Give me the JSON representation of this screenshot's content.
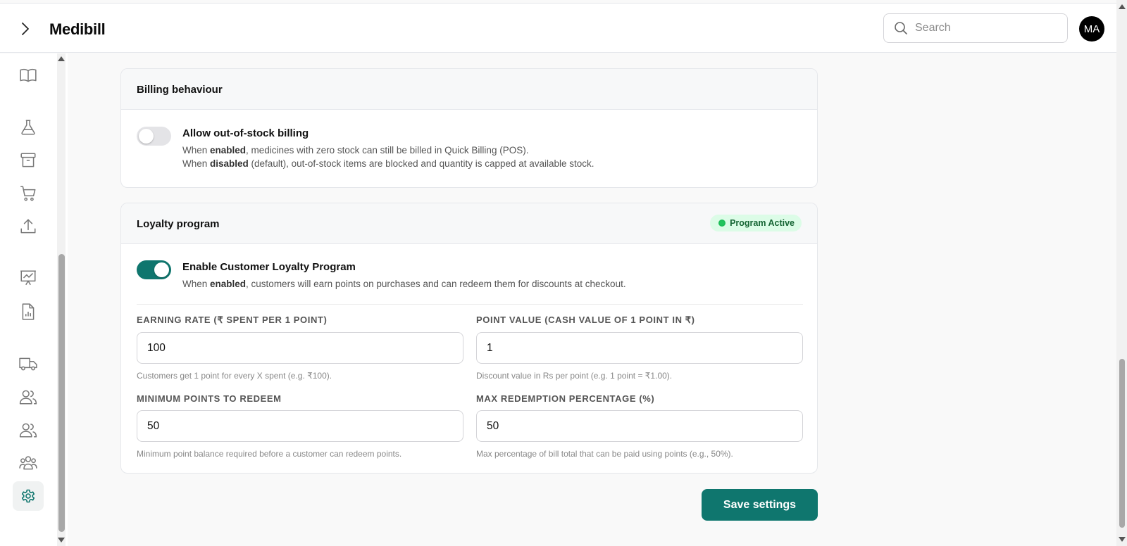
{
  "header": {
    "title": "Medibill",
    "search_placeholder": "Search",
    "avatar_initials": "MA"
  },
  "sidebar": {
    "items": [
      {
        "icon": "book-open-icon"
      },
      {
        "icon": "flask-icon"
      },
      {
        "icon": "archive-icon"
      },
      {
        "icon": "cart-icon"
      },
      {
        "icon": "upload-icon"
      },
      {
        "icon": "chart-presentation-icon"
      },
      {
        "icon": "file-chart-icon"
      },
      {
        "icon": "truck-icon"
      },
      {
        "icon": "users-icon"
      },
      {
        "icon": "users-alt-icon"
      },
      {
        "icon": "user-group-icon"
      },
      {
        "icon": "settings-icon",
        "active": true
      }
    ]
  },
  "billing": {
    "title": "Billing behaviour",
    "option_title": "Allow out-of-stock billing",
    "enabled": false,
    "line1_prefix": "When ",
    "line1_bold": "enabled",
    "line1_rest": ", medicines with zero stock can still be billed in Quick Billing (POS).",
    "line2_prefix": "When ",
    "line2_bold": "disabled",
    "line2_rest": " (default), out-of-stock items are blocked and quantity is capped at available stock."
  },
  "loyalty": {
    "title": "Loyalty program",
    "badge": "Program Active",
    "option_title": "Enable Customer Loyalty Program",
    "enabled": true,
    "desc_prefix": "When ",
    "desc_bold": "enabled",
    "desc_rest": ", customers will earn points on purchases and can redeem them for discounts at checkout.",
    "fields": {
      "earning_rate": {
        "label": "EARNING RATE (₹ SPENT PER 1 POINT)",
        "value": "100",
        "help": "Customers get 1 point for every X spent (e.g. ₹100)."
      },
      "point_value": {
        "label": "POINT VALUE (CASH VALUE OF 1 POINT IN ₹)",
        "value": "1",
        "help": "Discount value in Rs per point (e.g. 1 point = ₹1.00)."
      },
      "min_points": {
        "label": "MINIMUM POINTS TO REDEEM",
        "value": "50",
        "help": "Minimum point balance required before a customer can redeem points."
      },
      "max_redemption": {
        "label": "MAX REDEMPTION PERCENTAGE (%)",
        "value": "50",
        "help": "Max percentage of bill total that can be paid using points (e.g., 50%)."
      }
    }
  },
  "actions": {
    "save_label": "Save settings"
  },
  "colors": {
    "accent": "#0f766e",
    "badge_bg": "#dcfce7",
    "badge_text": "#166534"
  }
}
